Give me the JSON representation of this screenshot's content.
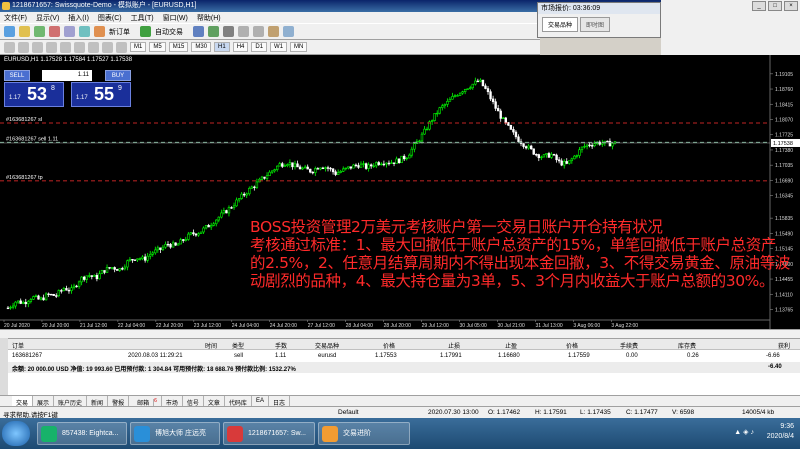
{
  "window": {
    "title": "1218671657: Swissquote-Demo - 模拟账户 - [EURUSD,H1]",
    "controls": [
      "_",
      "□",
      "×"
    ]
  },
  "menu": [
    "文件(F)",
    "显示(V)",
    "插入(I)",
    "图表(C)",
    "工具(T)",
    "窗口(W)",
    "帮助(H)"
  ],
  "toolbar": {
    "new_order": "新订单",
    "auto_trade": "自动交易"
  },
  "timeframes": [
    "M1",
    "M5",
    "M15",
    "M30",
    "H1",
    "H4",
    "D1",
    "W1",
    "MN"
  ],
  "active_timeframe": "H1",
  "quote_window": {
    "title": "市场报价: 03:36:09",
    "tabs": [
      "交易品种",
      "即时图"
    ]
  },
  "chart": {
    "label": "EURUSD,H1  1.17528 1.17584 1.17527 1.17538",
    "one_click": {
      "sell": "SELL",
      "buy": "BUY",
      "volume": "1.11",
      "sell_prefix": "1.17",
      "sell_big": "53",
      "sell_sup": "8",
      "buy_prefix": "1.17",
      "buy_big": "55",
      "buy_sup": "9"
    },
    "lines": [
      {
        "label": "#163681267 sl",
        "price": 1.17991,
        "color": "#ff3030",
        "style": "dash"
      },
      {
        "label": "#163681267 sell 1.11",
        "price": 1.17553,
        "color": "#7fbf9f",
        "style": "dash"
      },
      {
        "label": "#163681267 tp",
        "price": 1.1668,
        "color": "#ff3030",
        "style": "dash"
      }
    ],
    "current_price": "1.17538",
    "y_ticks": [
      "1.19105",
      "1.18760",
      "1.18415",
      "1.18070",
      "1.17725",
      "1.17380",
      "1.17035",
      "1.16690",
      "1.16345",
      "1.15835",
      "1.15490",
      "1.15145",
      "1.14800",
      "1.14455",
      "1.14110",
      "1.13765"
    ],
    "x_ticks": [
      "20 Jul 2020",
      "20 Jul 20:00",
      "21 Jul 12:00",
      "22 Jul 04:00",
      "22 Jul 20:00",
      "23 Jul 12:00",
      "24 Jul 04:00",
      "24 Jul 20:00",
      "27 Jul 12:00",
      "28 Jul 04:00",
      "28 Jul 20:00",
      "29 Jul 12:00",
      "30 Jul 05:00",
      "30 Jul 21:00",
      "31 Jul 13:00",
      "3 Aug 06:00",
      "3 Aug 22:00"
    ],
    "overlay_text": "BOSS投资管理2万美元考核账户第一交易日账户开仓持有状况\n考核通过标准：1、最大回撤低于账户总资产的15%，单笔回撤低于账户总资产的2.5%，2、任意月结算周期内不得出现本金回撤，3、不得交易黄金、原油等波动剧烈的品种，4、最大持仓量为3单，5、3个月内收益大于账户总额的30%。"
  },
  "chart_data": {
    "type": "candlestick",
    "symbol": "EURUSD",
    "timeframe": "H1",
    "ylim": [
      1.1355,
      1.1935
    ],
    "close_path": [
      1.138,
      1.1395,
      1.1392,
      1.1405,
      1.1398,
      1.141,
      1.1408,
      1.1425,
      1.142,
      1.1445,
      1.1455,
      1.1448,
      1.1465,
      1.1472,
      1.1468,
      1.1485,
      1.1495,
      1.149,
      1.1505,
      1.1512,
      1.1525,
      1.152,
      1.1535,
      1.1548,
      1.1552,
      1.1565,
      1.158,
      1.1595,
      1.161,
      1.1628,
      1.1645,
      1.166,
      1.1675,
      1.169,
      1.1705,
      1.171,
      1.17,
      1.1695,
      1.169,
      1.1702,
      1.1698,
      1.1685,
      1.1692,
      1.17,
      1.1705,
      1.1698,
      1.1708,
      1.1712,
      1.171,
      1.1715,
      1.1725,
      1.175,
      1.1775,
      1.1805,
      1.183,
      1.1845,
      1.1862,
      1.1875,
      1.1885,
      1.1895,
      1.187,
      1.1835,
      1.1805,
      1.178,
      1.176,
      1.1745,
      1.173,
      1.1722,
      1.1728,
      1.171,
      1.1705,
      1.1725,
      1.1745,
      1.1752,
      1.1755,
      1.1752,
      1.1754
    ]
  },
  "terminal": {
    "headers": [
      "订单",
      "时间",
      "类型",
      "手数",
      "交易品种",
      "价格",
      "止损",
      "止盈",
      "价格",
      "手续费",
      "库存费",
      "获利"
    ],
    "row": [
      "163681267",
      "2020.08.03 11:29:21",
      "sell",
      "1.11",
      "eurusd",
      "1.17553",
      "1.17991",
      "1.16680",
      "1.17559",
      "0.00",
      "0.26",
      "-6.66"
    ],
    "balance_text": "余额: 20 000.00 USD  净值: 19 993.60  已用预付款: 1 304.84  可用预付款: 18 688.76  预付款比例: 1532.27%",
    "balance_profit": "-6.40",
    "tabs": [
      "交易",
      "展示",
      "账户历史",
      "新闻",
      "警报",
      "邮箱",
      "市场",
      "信号",
      "文章",
      "代码库",
      "EA",
      "日志"
    ],
    "mail_badge": "6"
  },
  "status": {
    "help": "寻求帮助,请按F1键",
    "profile": "Default",
    "time": "2020.07.30 13:00",
    "open": "O: 1.17462",
    "high": "H: 1.17591",
    "low": "L: 1.17435",
    "close": "C: 1.17477",
    "volume": "V: 6598",
    "traffic": "14005/4 kb"
  },
  "taskbar": {
    "items": [
      "857438: Eightca...",
      "博旭大师 庄远亮",
      "1218671657: Sw...",
      "交易进阶"
    ],
    "time": "9:36",
    "date": "2020/8/4"
  }
}
